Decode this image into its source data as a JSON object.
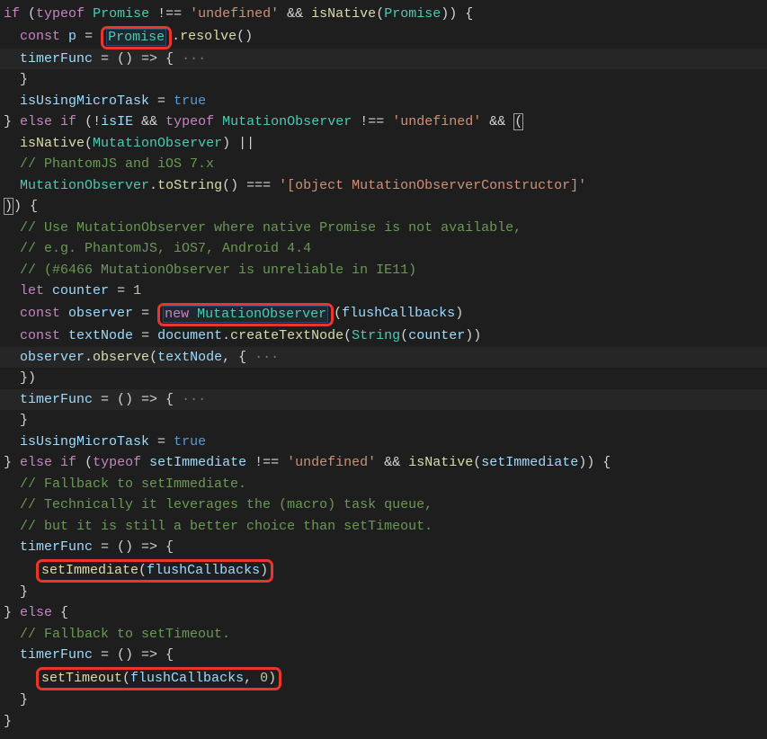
{
  "lines": {
    "l1_if": "if",
    "l1_typeof": "typeof",
    "l1_promise1": "Promise",
    "l1_undef": "'undefined'",
    "l1_amp": "&&",
    "l1_isnative": "isNative",
    "l1_promise2": "Promise",
    "l2_const": "const",
    "l2_p": "p",
    "l2_promise": "Promise",
    "l2_resolve": "resolve",
    "l3_timerFunc": "timerFunc",
    "l3_arrow": "() => {",
    "l3_ell": " ···",
    "l5_isUsing": "isUsingMicroTask",
    "l5_true": "true",
    "l6_else": "else",
    "l6_if": "if",
    "l6_isIE": "isIE",
    "l6_typeof": "typeof",
    "l6_mo": "MutationObserver",
    "l6_undef": "'undefined'",
    "l6_amp": "&&",
    "l7_isnative": "isNative",
    "l7_mo": "MutationObserver",
    "l8_cmt": "// PhantomJS and iOS 7.x",
    "l9_mo": "MutationObserver",
    "l9_tostr": "toString",
    "l9_str": "'[object MutationObserverConstructor]'",
    "l11_cmt": "// Use MutationObserver where native Promise is not available,",
    "l12_cmt": "// e.g. PhantomJS, iOS7, Android 4.4",
    "l13_cmt": "// (#6466 MutationObserver is unreliable in IE11)",
    "l14_let": "let",
    "l14_counter": "counter",
    "l14_one": "1",
    "l15_const": "const",
    "l15_observer": "observer",
    "l15_new": "new",
    "l15_mo": "MutationObserver",
    "l15_flush": "flushCallbacks",
    "l16_const": "const",
    "l16_textNode": "textNode",
    "l16_document": "document",
    "l16_create": "createTextNode",
    "l16_string": "String",
    "l16_counter": "counter",
    "l17_observer": "observer",
    "l17_observe": "observe",
    "l17_textNode": "textNode",
    "l17_ell": " ···",
    "l19_timerFunc": "timerFunc",
    "l19_arrow": "() => {",
    "l19_ell": " ···",
    "l21_isUsing": "isUsingMicroTask",
    "l21_true": "true",
    "l22_else": "else",
    "l22_if": "if",
    "l22_typeof": "typeof",
    "l22_setImm": "setImmediate",
    "l22_undef": "'undefined'",
    "l22_amp": "&&",
    "l22_isnative": "isNative",
    "l22_setImm2": "setImmediate",
    "l23_cmt": "// Fallback to setImmediate.",
    "l24_cmt": "// Technically it leverages the (macro) task queue,",
    "l25_cmt": "// but it is still a better choice than setTimeout.",
    "l26_timerFunc": "timerFunc",
    "l26_arrow": "() => {",
    "l27_setImm": "setImmediate",
    "l27_flush": "flushCallbacks",
    "l29_else": "else",
    "l30_cmt": "// Fallback to setTimeout.",
    "l31_timerFunc": "timerFunc",
    "l31_arrow": "() => {",
    "l32_setTimeout": "setTimeout",
    "l32_flush": "flushCallbacks",
    "l32_zero": "0"
  }
}
